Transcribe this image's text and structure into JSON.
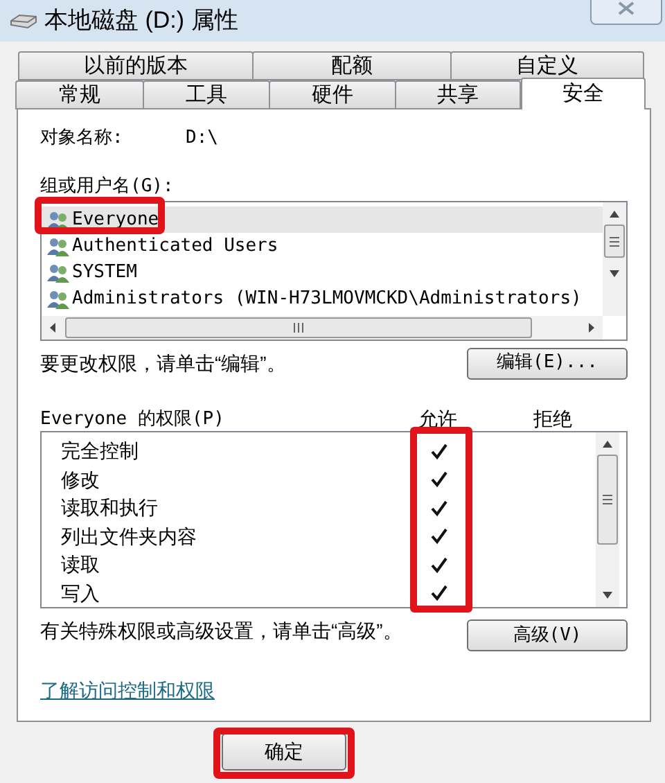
{
  "window": {
    "title": "本地磁盘 (D:) 属性"
  },
  "tabs_row_1": [
    {
      "label": "以前的版本",
      "selected": false
    },
    {
      "label": "配额",
      "selected": false
    },
    {
      "label": "自定义",
      "selected": false
    }
  ],
  "tabs_row_2": [
    {
      "label": "常规",
      "selected": false
    },
    {
      "label": "工具",
      "selected": false
    },
    {
      "label": "硬件",
      "selected": false
    },
    {
      "label": "共享",
      "selected": false
    },
    {
      "label": "安全",
      "selected": true
    }
  ],
  "object_name": {
    "label": "对象名称:",
    "value": "D:\\"
  },
  "users": {
    "label": "组或用户名(G):",
    "items": [
      {
        "name": "Everyone",
        "selected": true,
        "highlighted": true
      },
      {
        "name": "Authenticated Users",
        "selected": false,
        "highlighted": false
      },
      {
        "name": "SYSTEM",
        "selected": false,
        "highlighted": false
      },
      {
        "name": "Administrators (WIN-H73LMOVMCKD\\Administrators)",
        "selected": false,
        "highlighted": false
      }
    ]
  },
  "edit_hint": "要更改权限，请单击“编辑”。",
  "edit_button": "编辑(E)...",
  "permissions": {
    "label": "Everyone 的权限(P)",
    "allow_header": "允许",
    "deny_header": "拒绝",
    "allow_highlighted": true,
    "rows": [
      {
        "name": "完全控制",
        "allow": true
      },
      {
        "name": "修改",
        "allow": true
      },
      {
        "name": "读取和执行",
        "allow": true
      },
      {
        "name": "列出文件夹内容",
        "allow": true
      },
      {
        "name": "读取",
        "allow": true
      },
      {
        "name": "写入",
        "allow": true
      }
    ]
  },
  "advanced_hint": "有关特殊权限或高级设置，请单击“高级”。",
  "advanced_button": "高级(V)",
  "link": "了解访问控制和权限",
  "ok_button": {
    "label": "确定",
    "highlighted": true
  }
}
